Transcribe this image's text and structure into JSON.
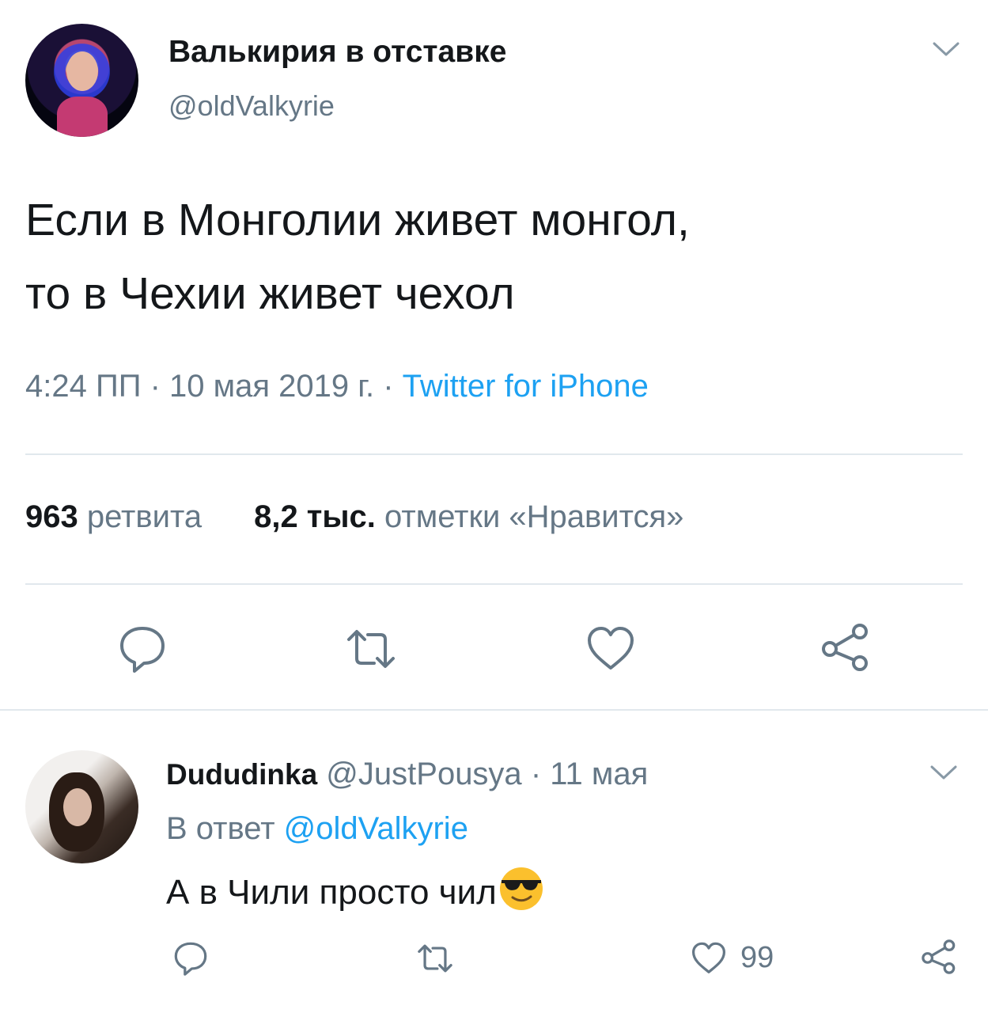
{
  "tweet": {
    "author_name": "Валькирия в отставке",
    "author_handle": "@oldValkyrie",
    "text_line1": "Если в Монголии живет монгол,",
    "text_line2": "то в Чехии живет чехол",
    "time": "4:24 ПП",
    "date": "10 мая 2019 г.",
    "meta_sep": "·",
    "source": "Twitter for iPhone",
    "retweet_count": "963",
    "retweet_label": "ретвита",
    "like_count": "8,2 тыс.",
    "like_label": "отметки «Нравится»",
    "icons": [
      "reply-icon",
      "retweet-icon",
      "like-icon",
      "share-icon",
      "chevron-down-icon"
    ]
  },
  "reply": {
    "author_name": "Dududinka",
    "author_handle": "@JustPousya",
    "sep": "·",
    "date": "11 мая",
    "reply_prefix": "В ответ",
    "reply_to": "@oldValkyrie",
    "text": "А в Чили просто чил",
    "emoji": "smiling-face-with-sunglasses",
    "like_count": "99"
  },
  "colors": {
    "text": "#14171a",
    "muted": "#657786",
    "link": "#1da1f2",
    "divider": "#e1e8ed",
    "emoji": "#fbc02d"
  }
}
